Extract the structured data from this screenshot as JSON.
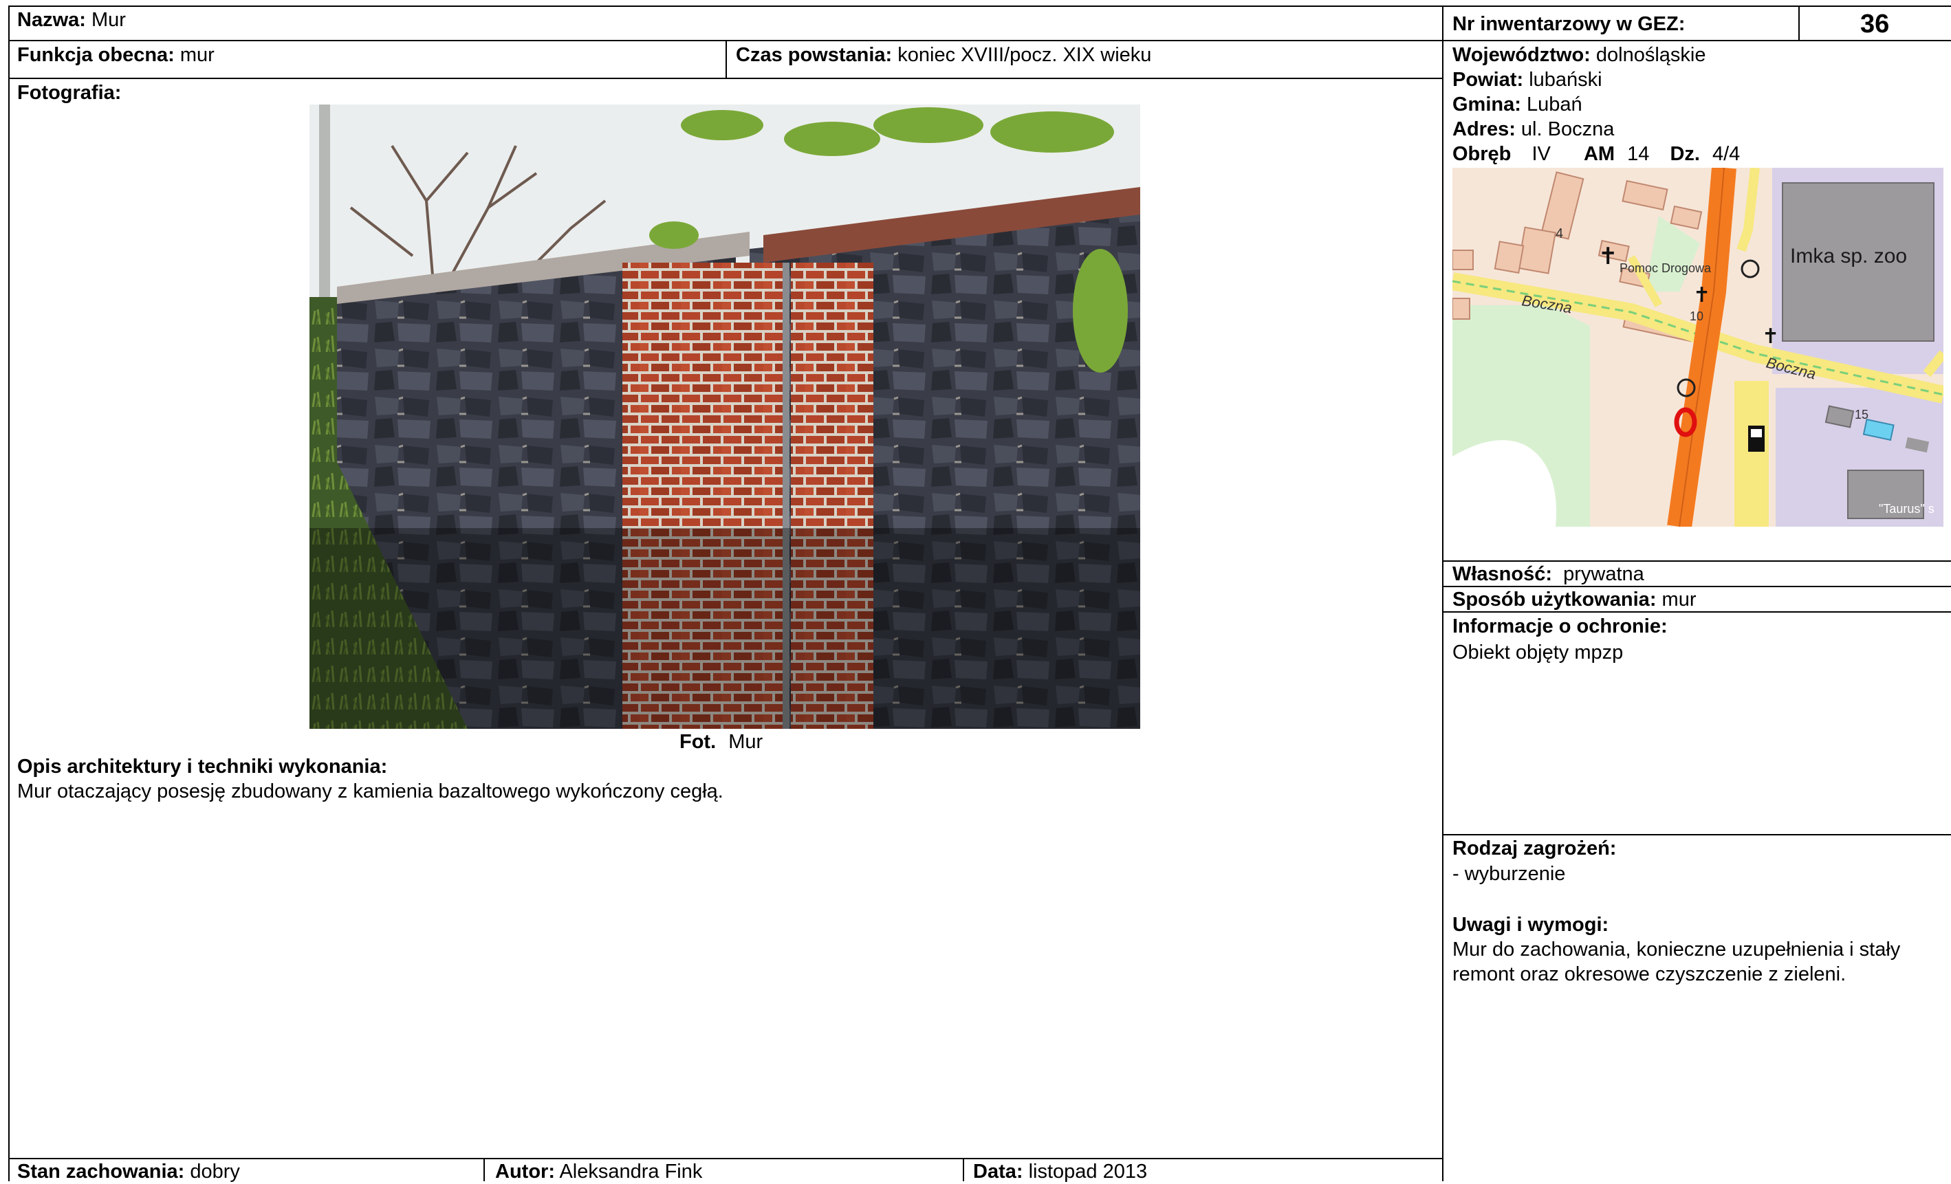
{
  "header": {
    "nazwa_label": "Nazwa:",
    "nazwa_value": "Mur",
    "nr_label": "Nr inwentarzowy w GEZ:",
    "nr_value": "36"
  },
  "row2": {
    "funkcja_label": "Funkcja obecna:",
    "funkcja_value": "mur",
    "czas_label": "Czas powstania:",
    "czas_value": "koniec XVIII/pocz. XIX wieku"
  },
  "location": {
    "wojewodztwo_label": "Województwo:",
    "wojewodztwo_value": "dolnośląskie",
    "powiat_label": "Powiat:",
    "powiat_value": "lubański",
    "gmina_label": "Gmina:",
    "gmina_value": "Lubań",
    "adres_label": "Adres:",
    "adres_value": "ul. Boczna",
    "obreb_label": "Obręb",
    "obreb_value": "IV",
    "am_label": "AM",
    "am_value": "14",
    "dz_label": "Dz.",
    "dz_value": "4/4"
  },
  "photo": {
    "section_label": "Fotografia:",
    "caption_label": "Fot.",
    "caption_value": "Mur"
  },
  "description": {
    "label": "Opis architektury i techniki wykonania:",
    "text": "Mur otaczający posesję zbudowany z kamienia bazaltowego wykończony cegłą."
  },
  "map": {
    "labels": {
      "company": "Imka sp. zoo",
      "pomoc": "Pomoc Drogowa",
      "boczna1": "Boczna",
      "boczna2": "Boczna",
      "taurus": "\"Taurus\" s",
      "n4": "4",
      "n10": "10",
      "n15": "15"
    }
  },
  "right": {
    "wlasnosc_label": "Własność:",
    "wlasnosc_value": "prywatna",
    "sposob_label": "Sposób użytkowania:",
    "sposob_value": "mur",
    "ochrona_label": "Informacje o ochronie:",
    "ochrona_value": "Obiekt objęty mpzp",
    "zagrozenia_label": "Rodzaj zagrożeń:",
    "zagrozenia_value": "- wyburzenie",
    "uwagi_label": "Uwagi i wymogi:",
    "uwagi_line1": "Mur do zachowania, konieczne uzupełnienia i stały",
    "uwagi_line2": "remont oraz okresowe czyszczenie z zieleni."
  },
  "footer": {
    "stan_label": "Stan zachowania:",
    "stan_value": "dobry",
    "autor_label": "Autor:",
    "autor_value": "Aleksandra Fink",
    "data_label": "Data:",
    "data_value": "listopad 2013"
  },
  "colors": {
    "road_orange": "#f47a20",
    "building": "#f0c8b0",
    "green_area": "#d8f0d0",
    "purple_area": "#d8d0e8",
    "marker_red": "#e01010"
  }
}
